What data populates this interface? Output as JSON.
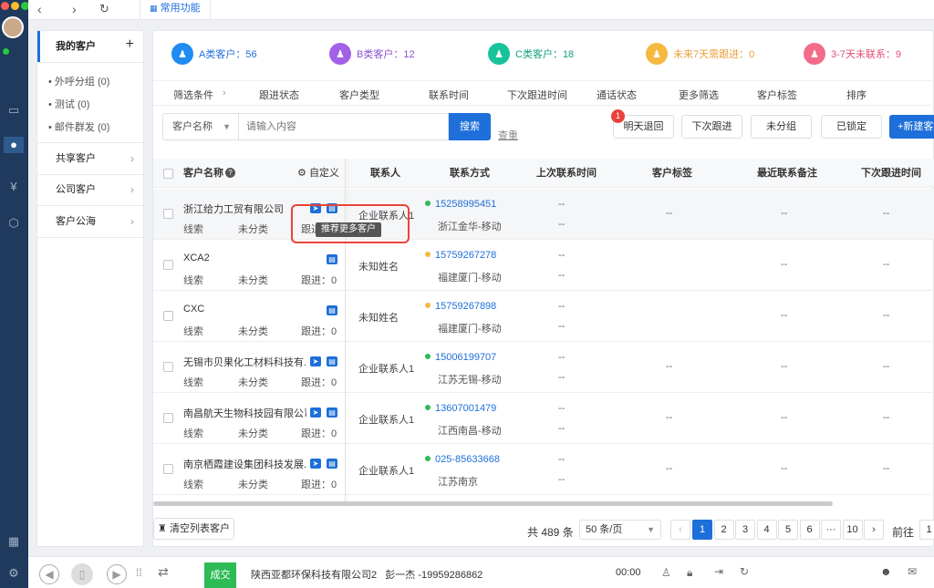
{
  "topbar": {
    "tab_label": "常用功能"
  },
  "sidebar": {
    "my_customers": "我的客户",
    "subitems": [
      "外呼分组 (0)",
      "测试 (0)",
      "邮件群发 (0)"
    ],
    "shared": "共享客户",
    "company": "公司客户",
    "pool": "客户公海"
  },
  "stats": [
    {
      "label": "A类客户：56",
      "color": "#1e8cf0",
      "bg": "#eaf4ff",
      "text": "#1e6fd9"
    },
    {
      "label": "B类客户：12",
      "color": "#a361e8",
      "bg": "#f4ecfd",
      "text": "#8e4fd3"
    },
    {
      "label": "C类客户：18",
      "color": "#17c39b",
      "bg": "#e7f9f3",
      "text": "#12a07f"
    },
    {
      "label": "未来7天需跟进：0",
      "color": "#f5b942",
      "bg": "#fff7e6",
      "text": "#e9a23b"
    },
    {
      "label": "3-7天未联系：9",
      "color": "#f26c8a",
      "bg": "#fdecef",
      "text": "#e0507a"
    }
  ],
  "filters": [
    "筛选条件",
    "跟进状态",
    "客户类型",
    "联系时间",
    "下次跟进时间",
    "通话状态",
    "更多筛选",
    "客户标签",
    "排序"
  ],
  "search": {
    "field": "客户名称",
    "placeholder": "请输入内容",
    "button": "搜索",
    "link": "查重"
  },
  "actions": {
    "badge": "1",
    "tomorrow": "明天退回",
    "next": "下次跟进",
    "ungrouped": "未分组",
    "locked": "已锁定",
    "new": "+新建客户"
  },
  "table": {
    "headers": {
      "name": "客户名称",
      "custom": "自定义",
      "contact": "联系人",
      "method": "联系方式",
      "last_time": "上次联系时间",
      "tags": "客户标签",
      "remark": "最近联系备注",
      "next_time": "下次跟进时间"
    },
    "tooltip": "推荐更多客户",
    "rows": [
      {
        "name": "浙江给力工贸有限公司",
        "type": "线索",
        "group": "未分类",
        "follow": "跟进：0",
        "contact": "企业联系人1",
        "phone": "15258995451",
        "dot": "#2dbb55",
        "location": "浙江金华-移动",
        "last1": "--",
        "last2": "--",
        "tags": "--",
        "remark": "--",
        "next": "--"
      },
      {
        "name": "XCA2",
        "type": "线索",
        "group": "未分类",
        "follow": "跟进：0",
        "contact": "未知姓名",
        "phone": "15759267278",
        "dot": "#f5b942",
        "location": "福建厦门-移动",
        "last1": "--",
        "last2": "--",
        "tags": "",
        "remark": "--",
        "next": "--"
      },
      {
        "name": "CXC",
        "type": "线索",
        "group": "未分类",
        "follow": "跟进：0",
        "contact": "未知姓名",
        "phone": "15759267898",
        "dot": "#f5b942",
        "location": "福建厦门-移动",
        "last1": "--",
        "last2": "--",
        "tags": "",
        "remark": "--",
        "next": "--"
      },
      {
        "name": "无锡市贝果化工材料科技有...",
        "type": "线索",
        "group": "未分类",
        "follow": "跟进：0",
        "contact": "企业联系人1",
        "phone": "15006199707",
        "dot": "#2dbb55",
        "location": "江苏无锡-移动",
        "last1": "--",
        "last2": "--",
        "tags": "--",
        "remark": "--",
        "next": "--"
      },
      {
        "name": "南昌航天生物科技园有限公司",
        "type": "线索",
        "group": "未分类",
        "follow": "跟进：0",
        "contact": "企业联系人1",
        "phone": "13607001479",
        "dot": "#2dbb55",
        "location": "江西南昌-移动",
        "last1": "--",
        "last2": "--",
        "tags": "--",
        "remark": "--",
        "next": "--"
      },
      {
        "name": "南京栖霞建设集团科技发展...",
        "type": "线索",
        "group": "未分类",
        "follow": "跟进：0",
        "contact": "企业联系人1",
        "phone": "025-85633668",
        "dot": "#2dbb55",
        "location": "江苏南京",
        "last1": "--",
        "last2": "--",
        "tags": "--",
        "remark": "--",
        "next": "--"
      }
    ]
  },
  "footer": {
    "clear": "清空列表客户",
    "total": "共 489 条",
    "per_page": "50 条/页",
    "pages": [
      "1",
      "2",
      "3",
      "4",
      "5",
      "6",
      "···",
      "10"
    ],
    "goto": "前往",
    "goto_value": "1"
  },
  "bottom": {
    "deal": "成交",
    "caller": "陕西亚都环保科技有限公司2   彭一杰 -19959286862",
    "timer": "00:00"
  }
}
